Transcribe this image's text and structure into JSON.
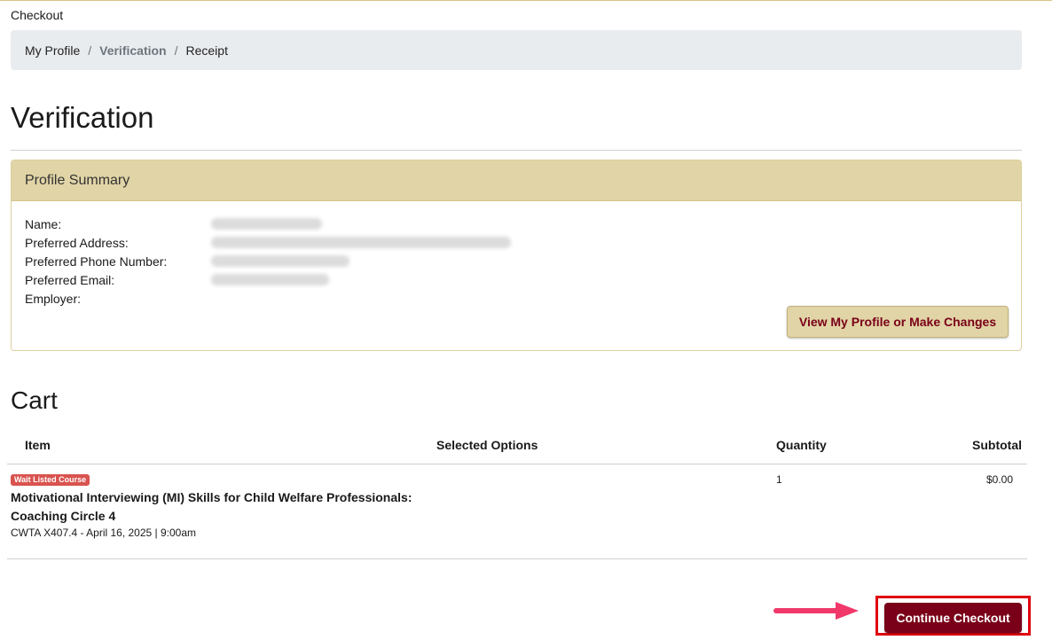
{
  "page_label": "Checkout",
  "breadcrumb": [
    {
      "label": "My Profile"
    },
    {
      "label": "Verification"
    },
    {
      "label": "Receipt"
    }
  ],
  "breadcrumb_separator": "/",
  "page_title": "Verification",
  "profile": {
    "header": "Profile Summary",
    "fields": [
      {
        "label": "Name:"
      },
      {
        "label": "Preferred Address:"
      },
      {
        "label": "Preferred Phone Number:"
      },
      {
        "label": "Preferred Email:"
      },
      {
        "label": "Employer:"
      }
    ],
    "button_label": "View My Profile or Make Changes"
  },
  "cart": {
    "title": "Cart",
    "columns": [
      "Item",
      "Selected Options",
      "Quantity",
      "Subtotal"
    ],
    "items": [
      {
        "badge": "Wait Listed Course",
        "name": "Motivational Interviewing (MI) Skills for Child Welfare Professionals: Coaching Circle 4",
        "meta": "CWTA X407.4 - April 16, 2025 | 9:00am",
        "quantity": "1",
        "subtotal": "$0.00"
      }
    ]
  },
  "continue_label": "Continue Checkout",
  "colors": {
    "brand_maroon": "#7a0019",
    "gold": "#e1d4a6",
    "badge_red": "#d9534f",
    "highlight_red": "#e0000f",
    "arrow_pink": "#f0386b"
  }
}
